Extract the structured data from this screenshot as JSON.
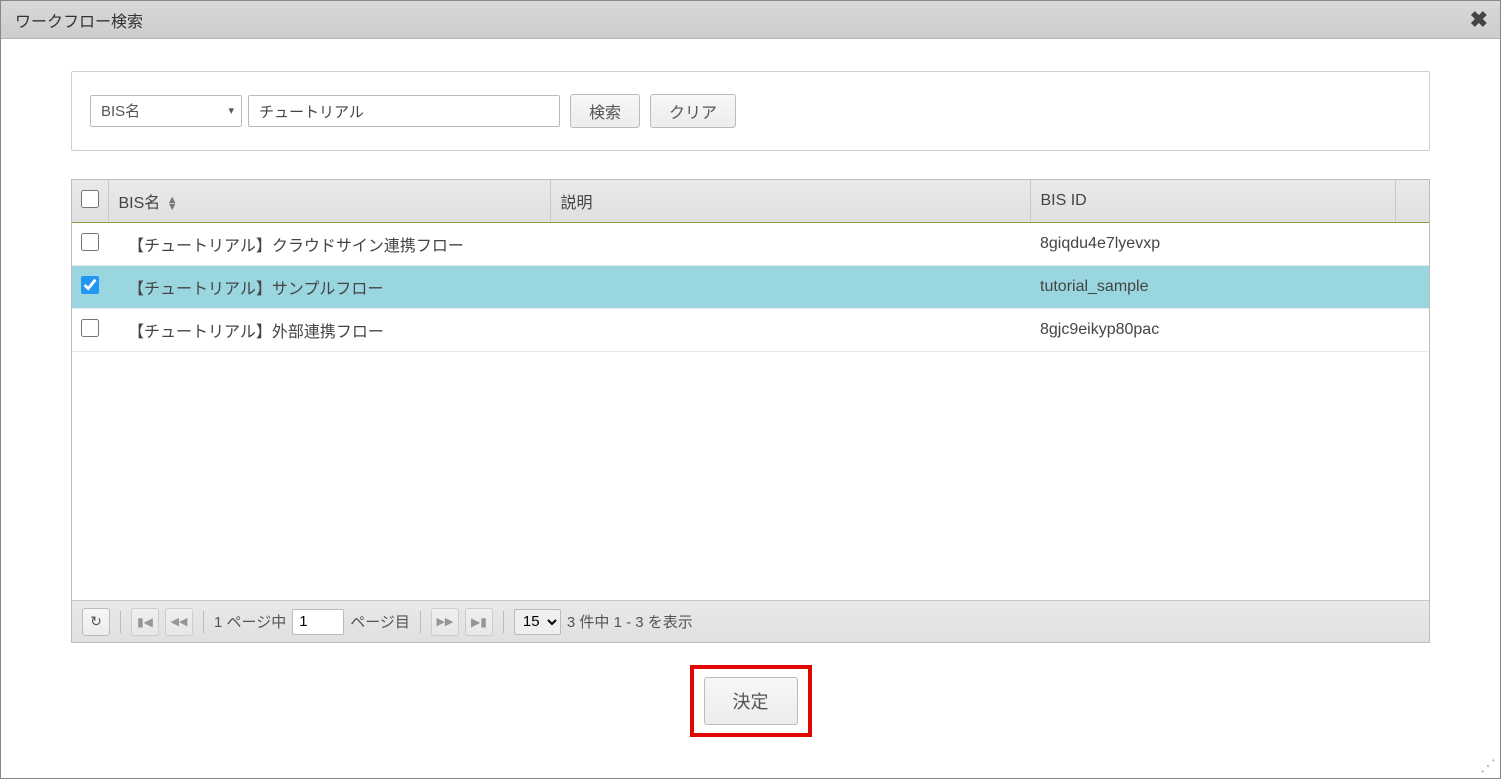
{
  "dialog": {
    "title": "ワークフロー検索"
  },
  "search": {
    "select_value": "BIS名",
    "input_value": "チュートリアル",
    "search_button": "検索",
    "clear_button": "クリア"
  },
  "table": {
    "headers": {
      "bis_name": "BIS名",
      "desc": "説明",
      "bis_id": "BIS ID"
    },
    "rows": [
      {
        "checked": false,
        "bis_name": "【チュートリアル】クラウドサイン連携フロー",
        "desc": "",
        "bis_id": "8giqdu4e7lyevxp"
      },
      {
        "checked": true,
        "bis_name": "【チュートリアル】サンプルフロー",
        "desc": "",
        "bis_id": "tutorial_sample"
      },
      {
        "checked": false,
        "bis_name": "【チュートリアル】外部連携フロー",
        "desc": "",
        "bis_id": "8gjc9eikyp80pac"
      }
    ]
  },
  "pager": {
    "prefix": "1 ページ中",
    "current_page": "1",
    "suffix": "ページ目",
    "page_size": "15",
    "summary": "3 件中 1 - 3 を表示"
  },
  "footer": {
    "decide_button": "決定"
  },
  "icons": {
    "refresh": "↻",
    "first": "⏮",
    "prev": "◀◀",
    "next": "▶▶",
    "last": "⏭"
  }
}
